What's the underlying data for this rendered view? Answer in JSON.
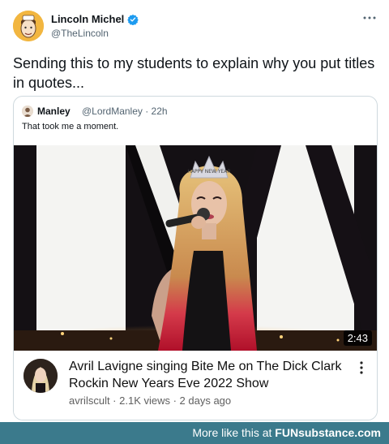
{
  "tweet": {
    "author_name": "Lincoln Michel",
    "author_handle": "@TheLincoln",
    "text": "Sending this to my students to explain why you put titles in quotes...",
    "avatar_icon": "cartoon-portrait-icon",
    "verified_icon": "verified-badge-icon",
    "more_icon": "more-options-icon",
    "verified_color": "#1d9bf0"
  },
  "quote": {
    "author_name": "Manley",
    "author_meta": "@LordManley · 22h",
    "text": "That took me a moment."
  },
  "video": {
    "duration": "2:43",
    "title": "Avril Lavigne singing Bite Me on The Dick Clark Rockin New Years Eve 2022 Show",
    "channel": "avrilscult",
    "meta": "avrilscult · 2.1K views · 2 days ago",
    "crown_text": "HAPPY NEW YEAR"
  },
  "footer": {
    "prefix": "More like this at ",
    "brand_fun": "FUN",
    "brand_rest": "substance.com",
    "color": "#3b7a8c"
  }
}
